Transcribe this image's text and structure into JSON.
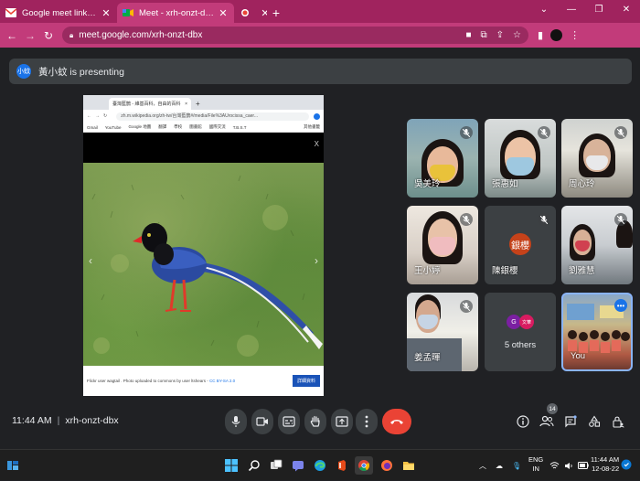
{
  "browser": {
    "tabs": [
      {
        "title": "Google meet link - jaspreet.k@",
        "favicon": "gmail-icon",
        "active": false
      },
      {
        "title": "Meet - xrh-onzt-dbx",
        "favicon": "meet-icon",
        "active": true
      },
      {
        "title": "",
        "favicon": "recording-icon",
        "active": false
      }
    ],
    "new_tab": "+",
    "url": "meet.google.com/xrh-onzt-dbx",
    "accent_color": "#c23b7a"
  },
  "presenting_banner": {
    "avatar_text": "小蚊",
    "text": "黃小蚊 is presenting"
  },
  "shared_screen": {
    "tab_title": "臺灣藍鵲 - 維基百科，自由的百科",
    "tab_close": "×",
    "new_tab": "+",
    "url": "zh.m.wikipedia.org/zh-tw/台灣藍鵲#/media/File%3AUrocissa_caer...",
    "bookmarks": [
      "Gmail",
      "YouTube",
      "Google 地圖",
      "翻譯",
      "學校",
      "圖書館",
      "國際交流",
      "T.B.S.T",
      "其他書籤"
    ],
    "close_label": "X",
    "caption": "Flickr user wagtail . Photo uploaded to commons by user ltshears - ",
    "license": "CC BY-SA 2.0",
    "details_button": "詳細資料"
  },
  "participants": [
    {
      "name": "吳美玲",
      "muted": true
    },
    {
      "name": "張惠如",
      "muted": true
    },
    {
      "name": "周心玲",
      "muted": true
    },
    {
      "name": "王小婷",
      "muted": true
    },
    {
      "name": "陳銀櫻",
      "muted": true,
      "avatar_text": "銀櫻"
    },
    {
      "name": "劉雅慧",
      "muted": true
    },
    {
      "name": "姜孟暉",
      "muted": true
    },
    {
      "name": "5 others",
      "avatars": [
        "G",
        "文華"
      ]
    },
    {
      "name": "You",
      "self": true
    }
  ],
  "meeting": {
    "time": "11:44 AM",
    "code": "xrh-onzt-dbx",
    "participant_count": "14"
  },
  "taskbar": {
    "lang_line1": "ENG",
    "lang_line2": "IN",
    "time": "11:44 AM",
    "date": "12-08-22"
  }
}
